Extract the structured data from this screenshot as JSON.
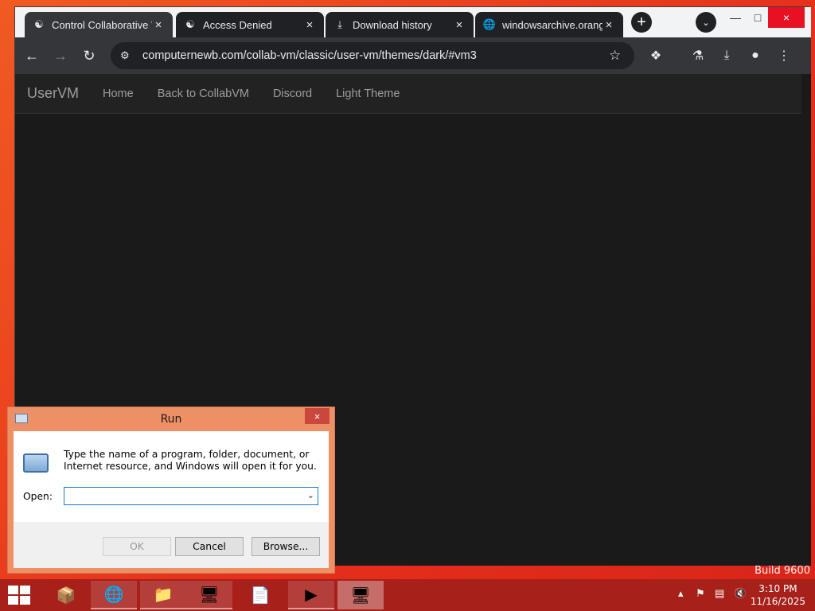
{
  "desktop": {
    "watermark": "Build 9600"
  },
  "browser": {
    "tabs": [
      {
        "label": "Control Collaborative V",
        "icon": "collabvm-icon"
      },
      {
        "label": "Access Denied",
        "icon": "collabvm-icon"
      },
      {
        "label": "Download history",
        "icon": "download-icon"
      },
      {
        "label": "windowsarchive.orange",
        "icon": "globe-icon"
      }
    ],
    "url": "computernewb.com/collab-vm/classic/user-vm/themes/dark/#vm3"
  },
  "site": {
    "brand": "UserVM",
    "links": [
      "Home",
      "Back to CollabVM",
      "Discord",
      "Light Theme"
    ]
  },
  "run_dialog": {
    "title": "Run",
    "description": "Type the name of a program, folder, document, or Internet resource, and Windows will open it for you.",
    "open_label": "Open:",
    "open_value": "",
    "ok_label": "OK",
    "cancel_label": "Cancel",
    "browse_label": "Browse..."
  },
  "taskbar": {
    "time": "3:10 PM",
    "date": "11/16/2025"
  }
}
